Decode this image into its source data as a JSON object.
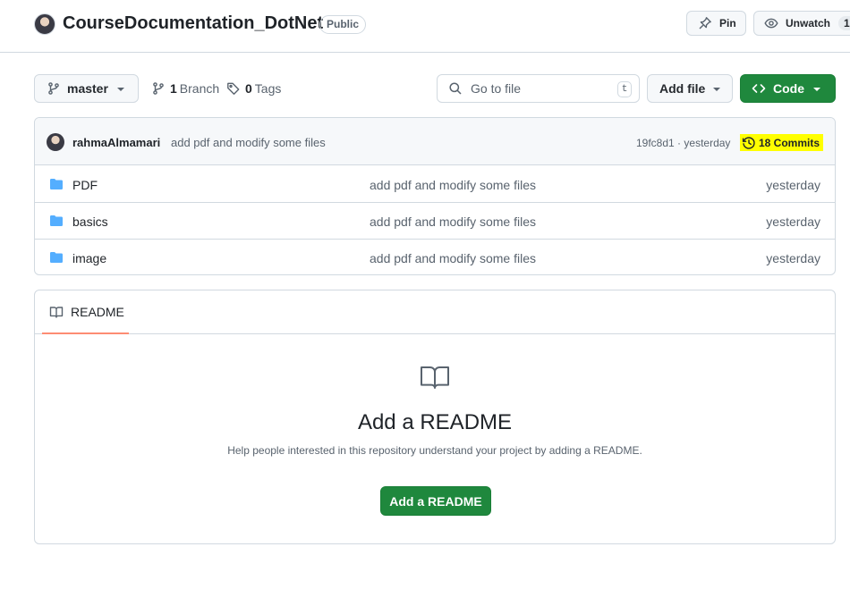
{
  "repo": {
    "name": "CourseDocumentation_DotNet",
    "visibility": "Public",
    "owner_avatar_icon": "user-avatar"
  },
  "header_actions": {
    "pin_label": "Pin",
    "unwatch_label": "Unwatch",
    "watch_count": "1"
  },
  "toolbar": {
    "branch": "master",
    "branches_count": "1",
    "branches_label": "Branch",
    "tags_count": "0",
    "tags_label": "Tags",
    "search_placeholder": "Go to file",
    "search_shortcut": "t",
    "add_file_label": "Add file",
    "code_label": "Code",
    "code_color": "#1f883d"
  },
  "latest_commit": {
    "author": "rahmaAlmamari",
    "message": "add pdf and modify some files",
    "hash": "19fc8d1",
    "separator": "·",
    "time": "yesterday",
    "commits_label": "18 Commits",
    "highlight_color": "#ffff00"
  },
  "files": [
    {
      "name": "PDF",
      "type": "folder",
      "commit": "add pdf and modify some files",
      "age": "yesterday"
    },
    {
      "name": "basics",
      "type": "folder",
      "commit": "add pdf and modify some files",
      "age": "yesterday"
    },
    {
      "name": "image",
      "type": "folder",
      "commit": "add pdf and modify some files",
      "age": "yesterday"
    }
  ],
  "readme": {
    "tab_label": "README",
    "heading": "Add a README",
    "help_text": "Help people interested in this repository understand your project by adding a README.",
    "button_label": "Add a README",
    "tab_accent": "#fd8c73"
  }
}
